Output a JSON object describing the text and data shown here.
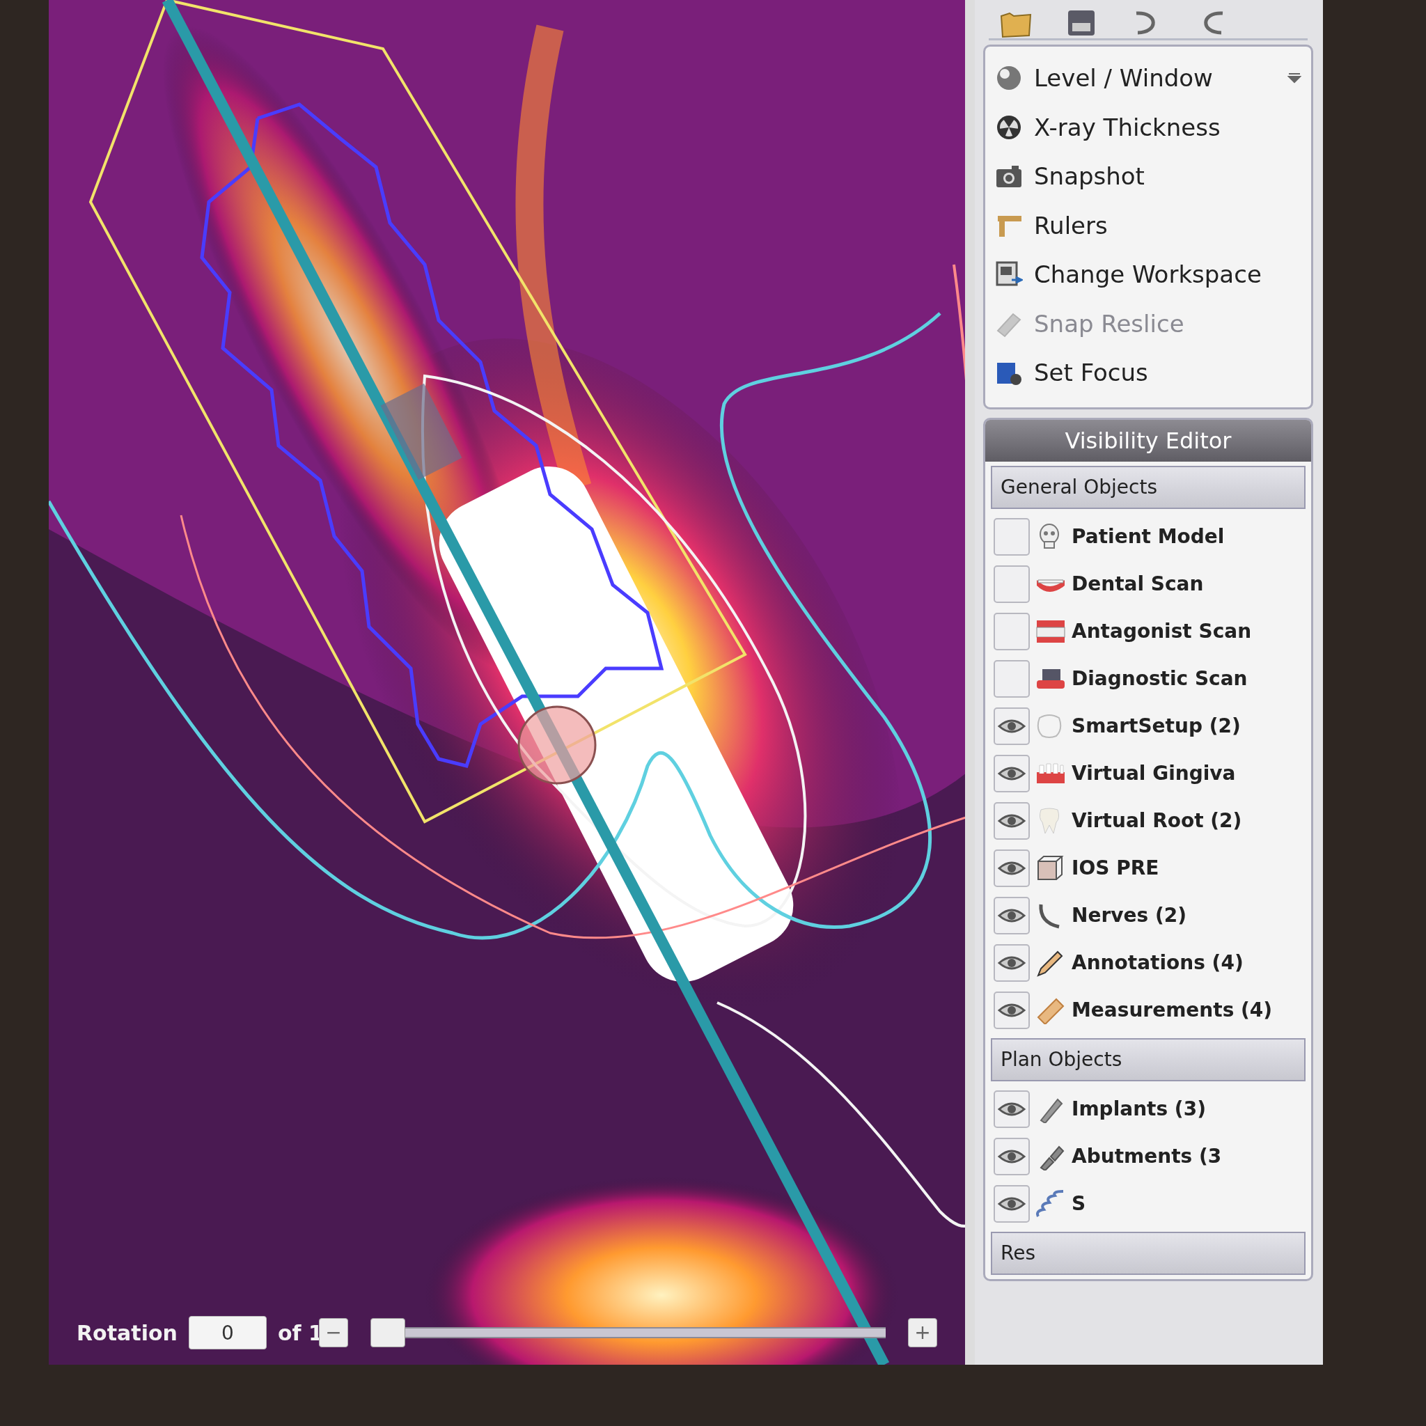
{
  "tools": [
    {
      "label": "Level / Window",
      "disabled": false,
      "dropdown": true
    },
    {
      "label": "X-ray Thickness",
      "disabled": false,
      "dropdown": false
    },
    {
      "label": "Snapshot",
      "disabled": false,
      "dropdown": false
    },
    {
      "label": "Rulers",
      "disabled": false,
      "dropdown": false
    },
    {
      "label": "Change Workspace",
      "disabled": false,
      "dropdown": false
    },
    {
      "label": "Snap Reslice",
      "disabled": true,
      "dropdown": false
    },
    {
      "label": "Set Focus",
      "disabled": false,
      "dropdown": false
    }
  ],
  "visibility_editor": {
    "title": "Visibility Editor",
    "sections": [
      {
        "title": "General Objects",
        "items": [
          {
            "label": "Patient Model",
            "visible": false
          },
          {
            "label": "Dental Scan",
            "visible": false
          },
          {
            "label": "Antagonist Scan",
            "visible": false
          },
          {
            "label": "Diagnostic Scan",
            "visible": false
          },
          {
            "label": "SmartSetup (2)",
            "visible": true
          },
          {
            "label": "Virtual Gingiva",
            "visible": true
          },
          {
            "label": "Virtual Root (2)",
            "visible": true
          },
          {
            "label": "IOS PRE",
            "visible": true
          },
          {
            "label": "Nerves (2)",
            "visible": true
          },
          {
            "label": "Annotations (4)",
            "visible": true
          },
          {
            "label": "Measurements (4)",
            "visible": true
          }
        ]
      },
      {
        "title": "Plan Objects",
        "items": [
          {
            "label": "Implants (3)",
            "visible": true
          },
          {
            "label": "Abutments (3",
            "visible": true
          },
          {
            "label": "S",
            "visible": true
          }
        ]
      },
      {
        "title": "Res"
      }
    ]
  },
  "rotation": {
    "label": "Rotation",
    "value": "0",
    "of": "of 1",
    "minus": "−",
    "plus": "+",
    "level": 0.0
  }
}
